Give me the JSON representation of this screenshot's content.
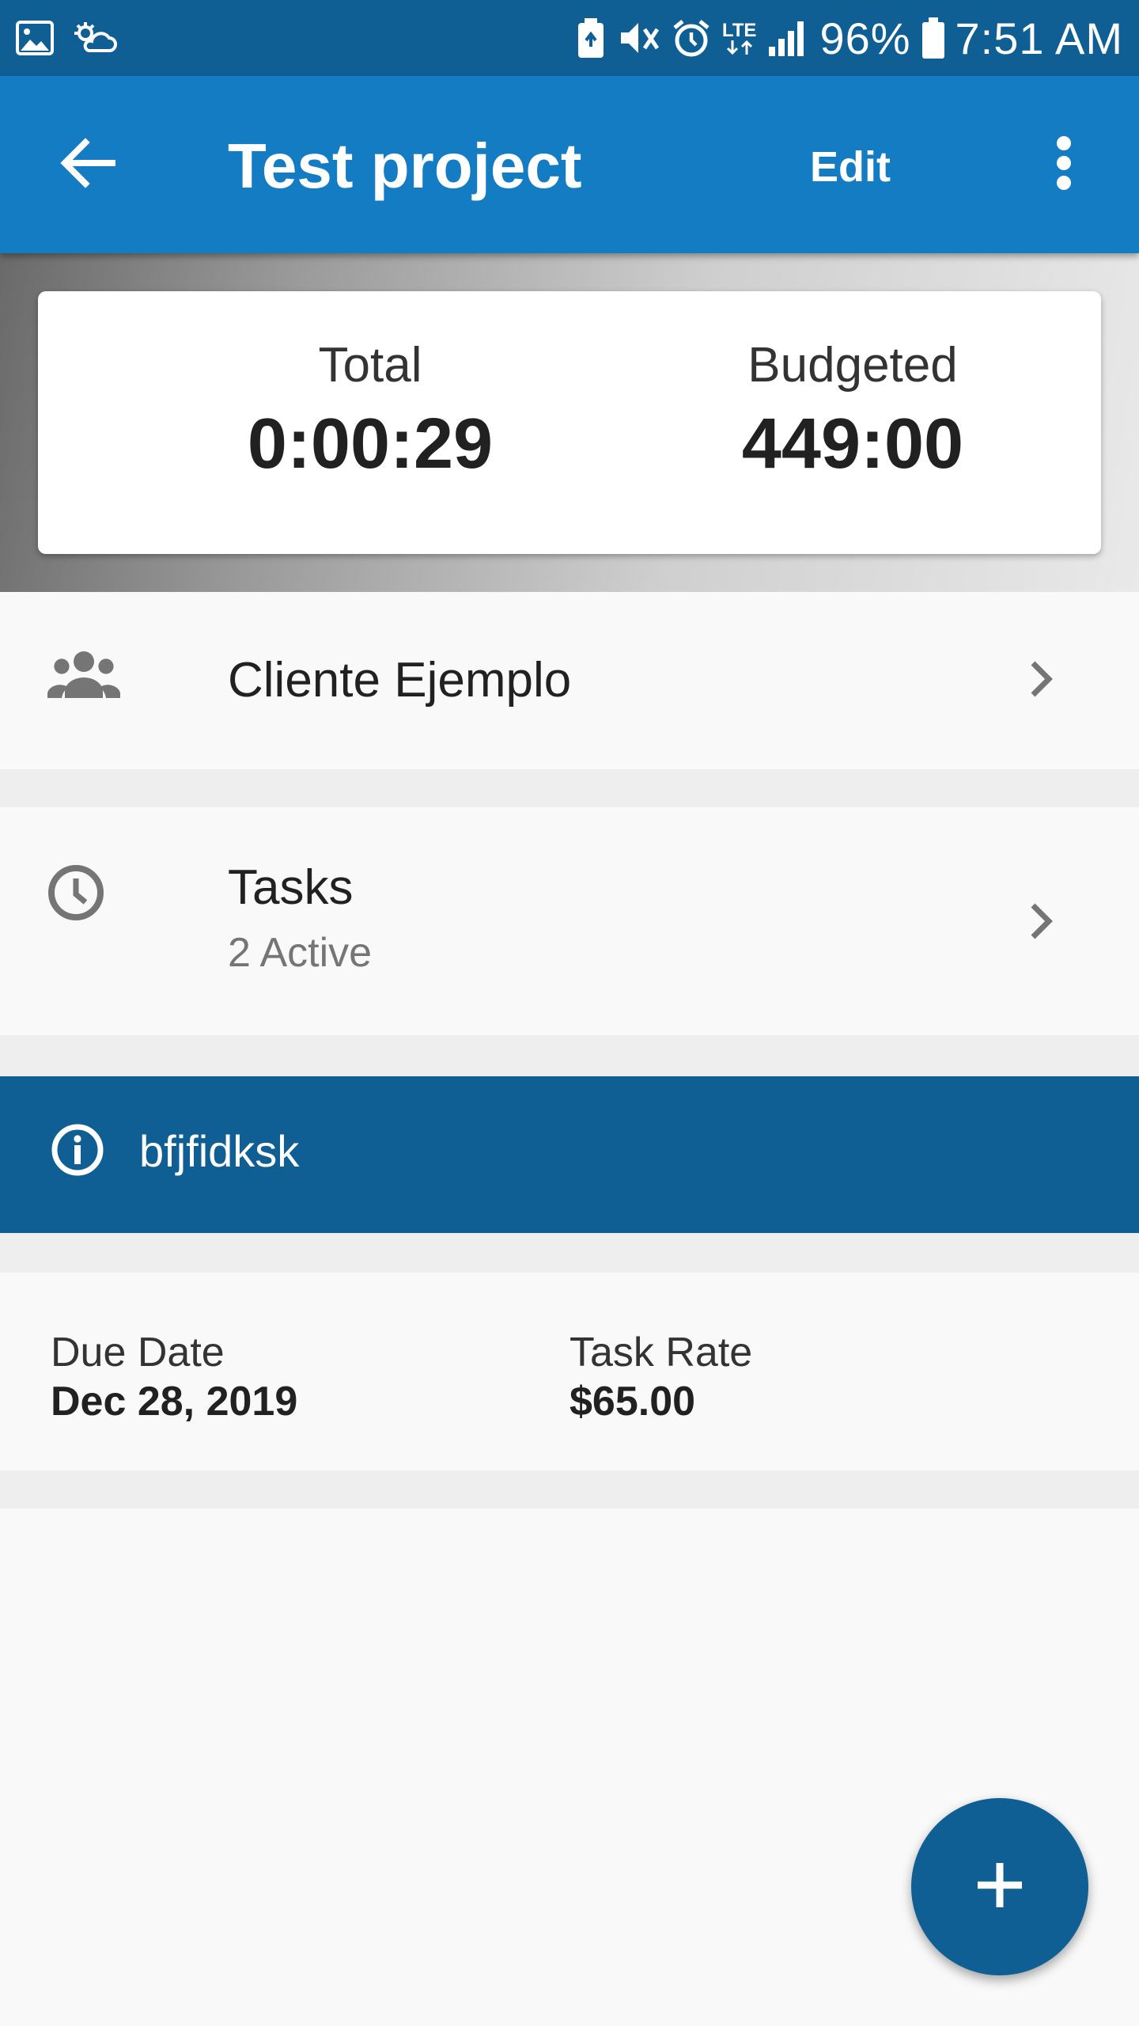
{
  "status_bar": {
    "battery": "96%",
    "time": "7:51 AM",
    "network": "LTE",
    "icons": [
      "image-icon",
      "weather-icon",
      "battery-saver-icon",
      "vibrate-icon",
      "alarm-icon",
      "lte-icon",
      "signal-icon",
      "battery-icon"
    ]
  },
  "app_bar": {
    "title": "Test project",
    "edit_label": "Edit",
    "back_icon": "arrow-back-icon",
    "more_icon": "more-vert-icon"
  },
  "summary": {
    "total_label": "Total",
    "total_value": "0:00:29",
    "budgeted_label": "Budgeted",
    "budgeted_value": "449:00"
  },
  "client": {
    "name": "Cliente Ejemplo",
    "icon": "people-icon"
  },
  "tasks": {
    "title": "Tasks",
    "subtitle": "2 Active",
    "icon": "clock-icon"
  },
  "info": {
    "text": "bfjfidksk",
    "icon": "info-icon"
  },
  "details": {
    "due_date_label": "Due Date",
    "due_date_value": "Dec 28, 2019",
    "task_rate_label": "Task Rate",
    "task_rate_value": "$65.00"
  },
  "fab": {
    "icon": "add-icon"
  },
  "colors": {
    "status_bar": "#0f5f95",
    "app_bar": "#147cc2",
    "banner": "#0f5f95",
    "fab": "#0f5f95"
  }
}
